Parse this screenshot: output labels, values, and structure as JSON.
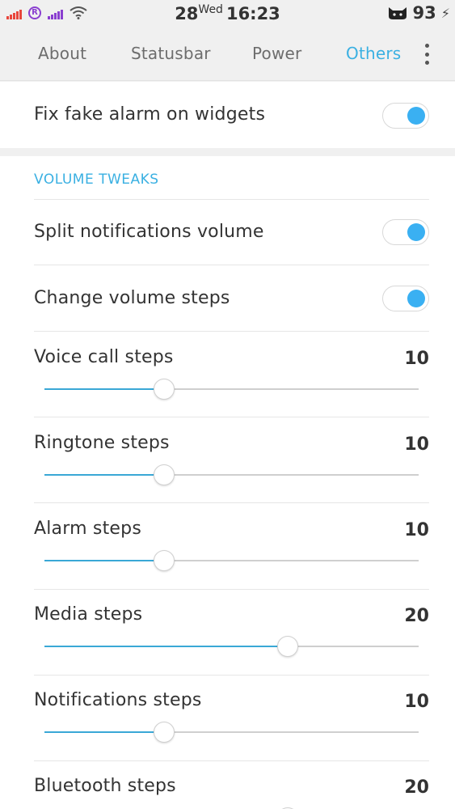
{
  "status_bar": {
    "date": "28",
    "weekday": "Wed",
    "time": "16:23",
    "battery": "93",
    "colors": {
      "signal1": "#e8463c",
      "signal2": "#8a3fd0"
    },
    "icons": [
      "signal-icon",
      "roaming-icon",
      "signal-icon",
      "wifi-icon",
      "cat-icon",
      "charging-icon"
    ]
  },
  "tabs": [
    {
      "label": "About",
      "active": false
    },
    {
      "label": "Statusbar",
      "active": false
    },
    {
      "label": "Power",
      "active": false
    },
    {
      "label": "Others",
      "active": true
    }
  ],
  "fix_fake_alarm": {
    "label": "Fix fake alarm on widgets",
    "enabled": true
  },
  "volume_tweaks": {
    "header": "VOLUME TWEAKS",
    "toggles": [
      {
        "label": "Split notifications volume",
        "enabled": true
      },
      {
        "label": "Change volume steps",
        "enabled": true
      }
    ],
    "sliders": [
      {
        "label": "Voice call steps",
        "value": "10",
        "level": 0.32
      },
      {
        "label": "Ringtone steps",
        "value": "10",
        "level": 0.32
      },
      {
        "label": "Alarm steps",
        "value": "10",
        "level": 0.32
      },
      {
        "label": "Media steps",
        "value": "20",
        "level": 0.65
      },
      {
        "label": "Notifications steps",
        "value": "10",
        "level": 0.32
      },
      {
        "label": "Bluetooth steps",
        "value": "20",
        "level": 0.65
      }
    ]
  },
  "accent_color": "#3ab0e2"
}
